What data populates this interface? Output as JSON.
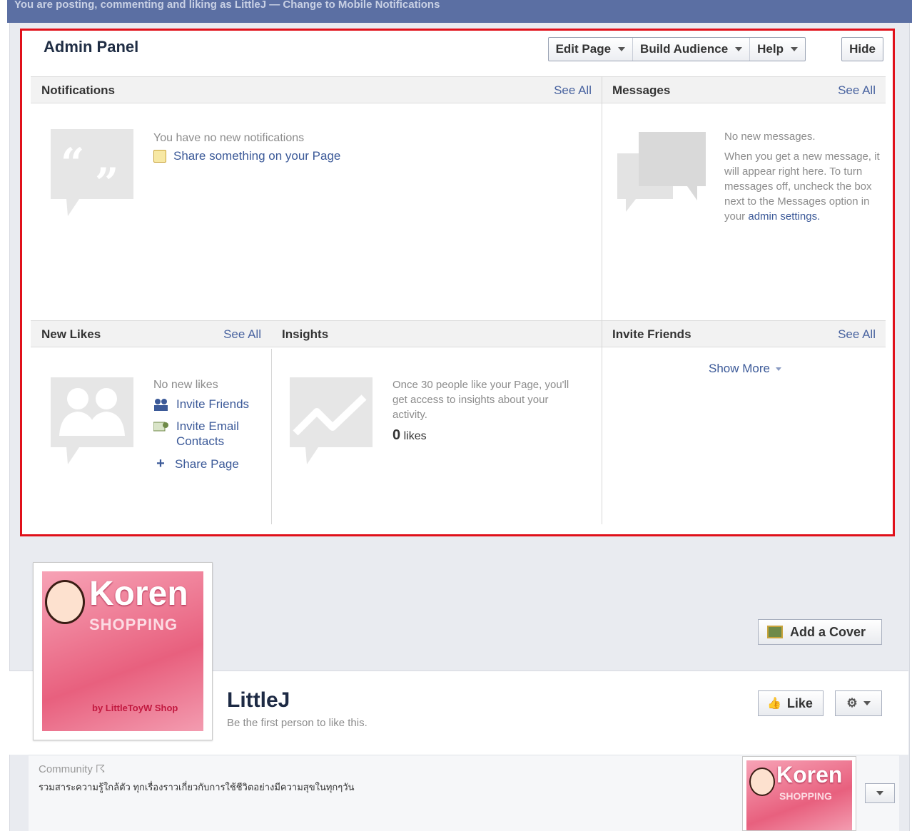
{
  "topbar": {
    "text": "You are posting, commenting and liking as LittleJ — Change to Mobile Notifications"
  },
  "admin": {
    "title": "Admin Panel",
    "buttons": [
      {
        "label": "Edit Page"
      },
      {
        "label": "Build Audience"
      },
      {
        "label": "Help"
      }
    ],
    "hide_label": "Hide"
  },
  "notifications": {
    "title": "Notifications",
    "see_all": "See All",
    "empty_text": "You have no new notifications",
    "share_link": "Share something on your Page"
  },
  "messages": {
    "title": "Messages",
    "see_all": "See All",
    "empty_text": "No new messages.",
    "help_text": "When you get a new message, it will appear right here. To turn messages off, uncheck the box next to the Messages option in your",
    "settings_link": "admin settings."
  },
  "new_likes": {
    "title": "New Likes",
    "see_all": "See All",
    "empty_text": "No new likes",
    "invite_friends": "Invite Friends",
    "invite_email": "Invite Email Contacts",
    "share_page": "Share Page"
  },
  "insights": {
    "title": "Insights",
    "text": "Once 30 people like your Page, you'll get access to insights about your activity.",
    "likes_count": "0",
    "likes_label": "likes"
  },
  "invite_friends": {
    "title": "Invite Friends",
    "see_all": "See All",
    "show_more": "Show More"
  },
  "profile": {
    "brand": "Koren",
    "brand_sub": "SHOPPING",
    "brand_bottom": "by LittleToyW Shop",
    "page_name": "LittleJ",
    "page_sub": "Be the first person to like this.",
    "add_cover": "Add a Cover",
    "like": "Like"
  },
  "info": {
    "category": "Community ☈",
    "description": "รวมสาระความรู้ใกล้ตัว ทุกเรื่องราวเกี่ยวกับการใช้ชีวิตอย่างมีความสุขในทุกๆวัน"
  }
}
